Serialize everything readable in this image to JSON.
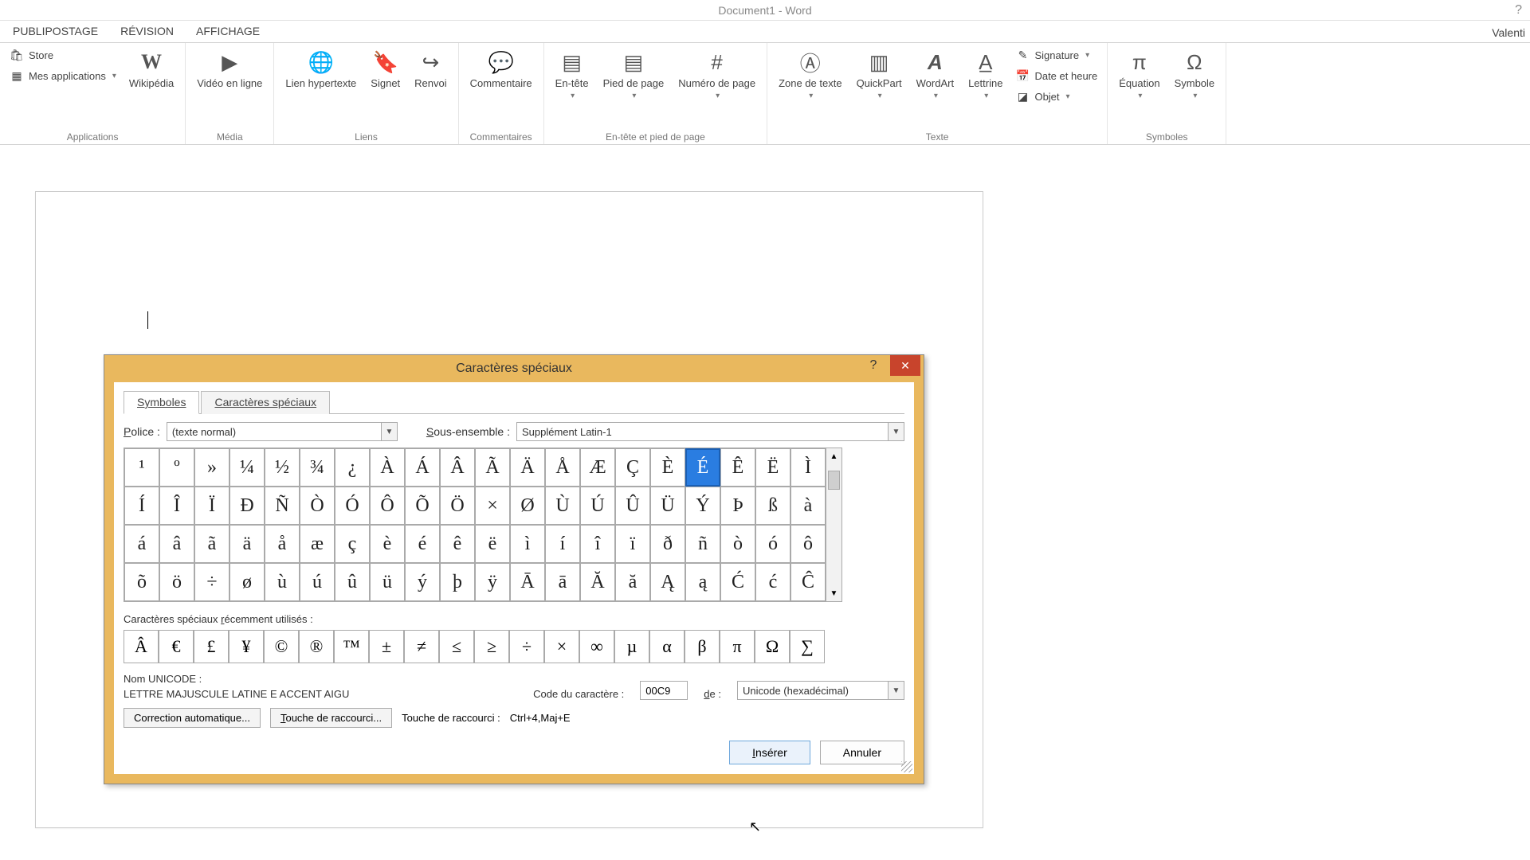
{
  "window": {
    "title": "Document1 - Word",
    "user": "Valenti"
  },
  "ribbon_tabs": [
    "PUBLIPOSTAGE",
    "RÉVISION",
    "AFFICHAGE"
  ],
  "ribbon": {
    "applications": {
      "store": "Store",
      "myapps": "Mes applications",
      "wikipedia": "Wikipédia",
      "group": "Applications"
    },
    "media": {
      "video": "Vidéo en ligne",
      "group": "Média"
    },
    "links": {
      "hyperlink": "Lien hypertexte",
      "bookmark": "Signet",
      "crossref": "Renvoi",
      "group": "Liens"
    },
    "comments": {
      "comment": "Commentaire",
      "group": "Commentaires"
    },
    "headerfooter": {
      "header": "En-tête",
      "footer": "Pied de page",
      "pagenum": "Numéro de page",
      "group": "En-tête et pied de page"
    },
    "text": {
      "textbox": "Zone de texte",
      "quickpart": "QuickPart",
      "wordart": "WordArt",
      "dropcap": "Lettrine",
      "signature": "Signature",
      "datetime": "Date et heure",
      "object": "Objet",
      "group": "Texte"
    },
    "symbols": {
      "equation": "Équation",
      "symbol": "Symbole",
      "group": "Symboles"
    }
  },
  "dialog": {
    "title": "Caractères spéciaux",
    "tab_symbols": "Symboles",
    "tab_special": "Caractères spéciaux",
    "font_label": "Police :",
    "font_value": "(texte normal)",
    "subset_label": "Sous-ensemble :",
    "subset_value": "Supplément Latin-1",
    "grid": [
      [
        "¹",
        "º",
        "»",
        "¼",
        "½",
        "¾",
        "¿",
        "À",
        "Á",
        "Â",
        "Ã",
        "Ä",
        "Å",
        "Æ",
        "Ç",
        "È",
        "É",
        "Ê",
        "Ë",
        "Ì"
      ],
      [
        "Í",
        "Î",
        "Ï",
        "Ð",
        "Ñ",
        "Ò",
        "Ó",
        "Ô",
        "Õ",
        "Ö",
        "×",
        "Ø",
        "Ù",
        "Ú",
        "Û",
        "Ü",
        "Ý",
        "Þ",
        "ß",
        "à"
      ],
      [
        "á",
        "â",
        "ã",
        "ä",
        "å",
        "æ",
        "ç",
        "è",
        "é",
        "ê",
        "ë",
        "ì",
        "í",
        "î",
        "ï",
        "ð",
        "ñ",
        "ò",
        "ó",
        "ô"
      ],
      [
        "õ",
        "ö",
        "÷",
        "ø",
        "ù",
        "ú",
        "û",
        "ü",
        "ý",
        "þ",
        "ÿ",
        "Ā",
        "ā",
        "Ă",
        "ă",
        "Ą",
        "ą",
        "Ć",
        "ć",
        "Ĉ"
      ]
    ],
    "selected": {
      "row": 0,
      "col": 16
    },
    "recent_label": "Caractères spéciaux récemment utilisés :",
    "recent": [
      "Â",
      "€",
      "£",
      "¥",
      "©",
      "®",
      "™",
      "±",
      "≠",
      "≤",
      "≥",
      "÷",
      "×",
      "∞",
      "µ",
      "α",
      "β",
      "π",
      "Ω",
      "∑"
    ],
    "unicode_name_label": "Nom UNICODE :",
    "unicode_name": "LETTRE MAJUSCULE LATINE E ACCENT AIGU",
    "charcode_label": "Code du caractère :",
    "charcode_value": "00C9",
    "from_label": "de :",
    "from_value": "Unicode (hexadécimal)",
    "autocorrect": "Correction automatique...",
    "shortcut_btn": "Touche de raccourci...",
    "shortcut_label": "Touche de raccourci :",
    "shortcut_value": "Ctrl+4,Maj+E",
    "insert": "Insérer",
    "cancel": "Annuler"
  }
}
